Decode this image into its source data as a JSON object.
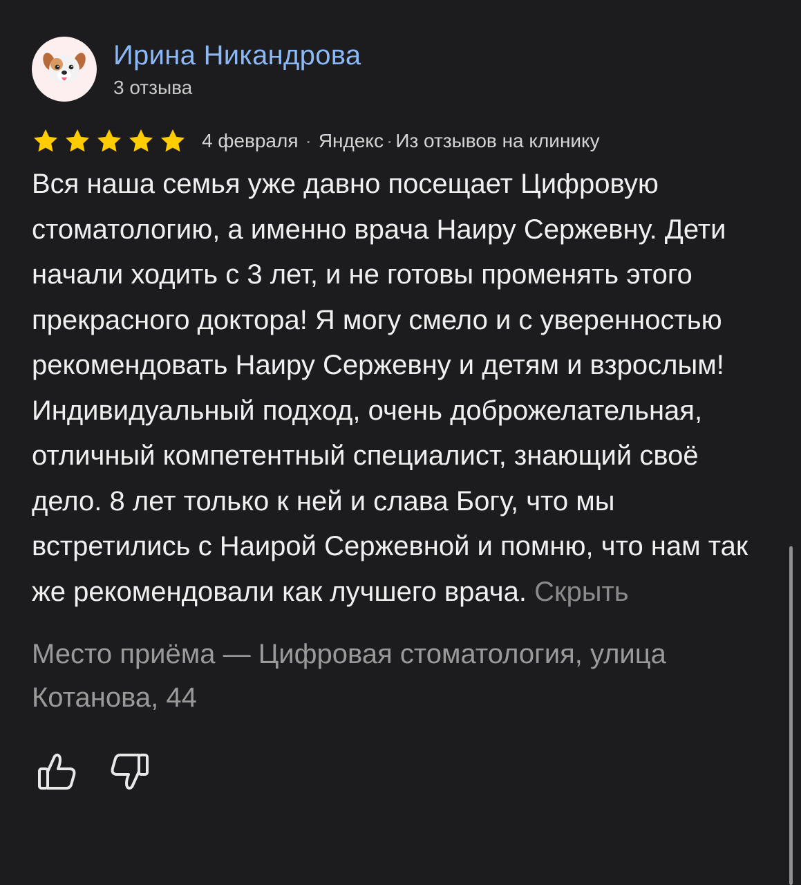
{
  "author": {
    "name": "Ирина Никандрова",
    "review_count": "3 отзыва",
    "avatar_icon": "puppy-face-icon"
  },
  "rating": {
    "stars": 5,
    "max_stars": 5,
    "star_color": "#ffcc00"
  },
  "meta": {
    "date": "4 февраля",
    "separator": "·",
    "source": "Яндекс",
    "origin": "Из отзывов на клинику"
  },
  "review": {
    "text": "Вся наша семья уже давно посещает Цифровую стоматологию, а именно врача Наиру Сержевну. Дети начали ходить с 3 лет, и не готовы променять этого прекрасного доктора! Я могу смело и с уверенностью рекомендовать Наиру Сержевну и детям и взрослым! Индивидуальный подход, очень доброжелательная, отличный компетентный специалист, знающий своё дело. 8 лет только к ней и слава Богу, что мы встретились с Наирой Сержевной и помню, что нам так же рекомендовали как лучшего врача.",
    "hide_label": "Скрыть"
  },
  "place": {
    "text": "Место приёма — Цифровая стоматология, улица Котанова, 44"
  },
  "actions": {
    "like_icon": "thumbs-up-icon",
    "dislike_icon": "thumbs-down-icon"
  },
  "colors": {
    "background": "#1c1b1e",
    "author_name": "#8cb8f5",
    "secondary_text": "#9a9a9a"
  }
}
